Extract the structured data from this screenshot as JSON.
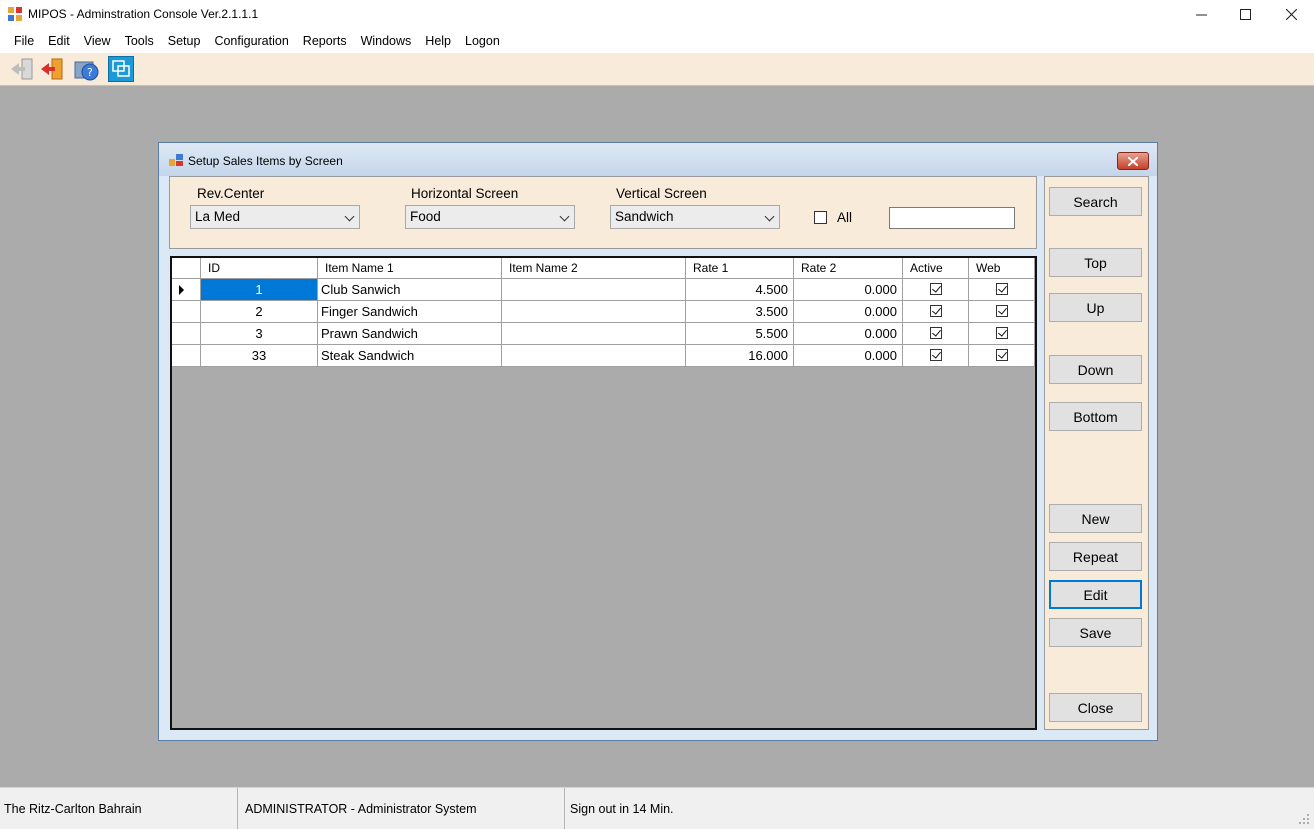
{
  "app": {
    "title": "MIPOS - Adminstration Console Ver.2.1.1.1",
    "window_controls": [
      "minimize",
      "maximize",
      "close"
    ]
  },
  "menu": {
    "items": [
      "File",
      "Edit",
      "View",
      "Tools",
      "Setup",
      "Configuration",
      "Reports",
      "Windows",
      "Help",
      "Logon"
    ]
  },
  "toolbar": {
    "buttons": [
      "login-icon",
      "logout-icon",
      "help-icon",
      "switch-window-icon"
    ]
  },
  "child_window": {
    "title": "Setup Sales Items by Screen",
    "filters": {
      "rev_center_label": "Rev.Center",
      "rev_center_value": "La Med",
      "horizontal_label": "Horizontal Screen",
      "horizontal_value": "Food",
      "vertical_label": "Vertical Screen",
      "vertical_value": "Sandwich",
      "all_label": "All",
      "all_checked": false,
      "search_value": ""
    },
    "grid": {
      "columns": [
        "ID",
        "Item Name 1",
        "Item Name 2",
        "Rate 1",
        "Rate 2",
        "Active",
        "Web"
      ],
      "rows": [
        {
          "id": "1",
          "name1": "Club Sanwich",
          "name2": "",
          "rate1": "4.500",
          "rate2": "0.000",
          "active": true,
          "web": true
        },
        {
          "id": "2",
          "name1": "Finger Sandwich",
          "name2": "",
          "rate1": "3.500",
          "rate2": "0.000",
          "active": true,
          "web": true
        },
        {
          "id": "3",
          "name1": "Prawn Sandwich",
          "name2": "",
          "rate1": "5.500",
          "rate2": "0.000",
          "active": true,
          "web": true
        },
        {
          "id": "33",
          "name1": "Steak Sandwich",
          "name2": "",
          "rate1": "16.000",
          "rate2": "0.000",
          "active": true,
          "web": true
        }
      ]
    },
    "buttons": {
      "search": "Search",
      "top": "Top",
      "up": "Up",
      "down": "Down",
      "bottom": "Bottom",
      "new": "New",
      "repeat": "Repeat",
      "edit": "Edit",
      "save": "Save",
      "close": "Close"
    }
  },
  "status": {
    "property": "The Ritz-Carlton Bahrain",
    "user": "ADMINISTRATOR - Administrator System",
    "signout": "Sign out in 14 Min."
  },
  "colors": {
    "panel_bg": "#f9ebda",
    "mdi_bg": "#ababab",
    "selection": "#0078d7"
  }
}
